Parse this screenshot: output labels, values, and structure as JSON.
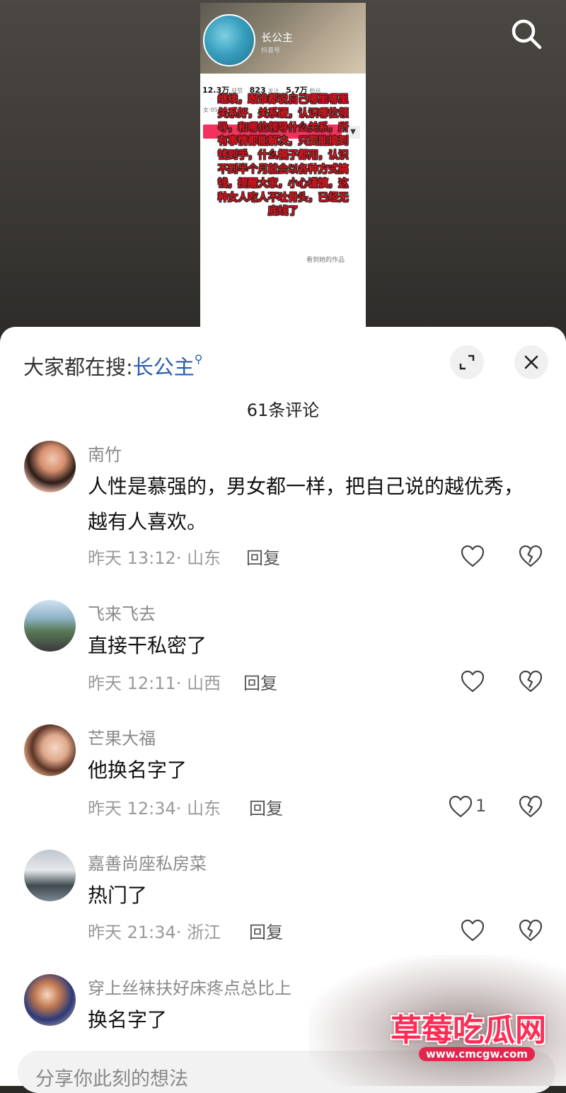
{
  "video": {
    "profile_name": "长公主",
    "profile_sub": "抖音号",
    "stats": [
      {
        "num": "12.3万",
        "label": "获赞"
      },
      {
        "num": "823",
        "label": "关注"
      },
      {
        "num": "5.7万",
        "label": "粉丝"
      }
    ],
    "bio_snippet": "女·95岁·",
    "works_hint": "看到她的作品",
    "overlay_text": "继续，跟谁都说自己哪里哪里关系好，关系硬，认识哪位领导，和哪位领导什么关系，所有事情都能解决，只要能搞到钱到手，什么幌子都用，认识不到半个月就会以各种方式搞钱，提醒大家，小心谨慎，这种女人吃人不吐骨头，已经无底线了"
  },
  "sheet": {
    "hot_search_label": "大家都在搜:",
    "hot_search_keyword": "长公主",
    "comment_count": "61条评论"
  },
  "comments": [
    {
      "user": "南竹",
      "text": "人性是慕强的，男女都一样，把自己说的越优秀，越有人喜欢。",
      "time": "昨天 13:12",
      "location": "山东",
      "reply": "回复",
      "likes": ""
    },
    {
      "user": "飞来飞去",
      "text": "直接干私密了",
      "time": "昨天 12:11",
      "location": "山西",
      "reply": "回复",
      "likes": ""
    },
    {
      "user": "芒果大福",
      "text": "他换名字了",
      "time": "昨天 12:34",
      "location": "山东",
      "reply": "回复",
      "likes": "1"
    },
    {
      "user": "嘉善尚座私房菜",
      "text": "热门了",
      "time": "昨天 21:34",
      "location": "浙江",
      "reply": "回复",
      "likes": ""
    },
    {
      "user": "穿上丝袜扶好床疼点总比上",
      "text": "换名字了"
    }
  ],
  "input": {
    "placeholder": "分享你此刻的想法"
  },
  "watermark": {
    "title": "草莓吃瓜网",
    "url": "www.cmcgw.com"
  },
  "icons": {
    "search": "search-icon",
    "expand": "expand-icon",
    "close": "close-icon",
    "like": "heart-outline-icon",
    "dislike": "broken-heart-icon"
  },
  "colors": {
    "accent_link": "#2a5caa",
    "overlay_red": "#e6111c",
    "watermark_pink": "#ff2d55"
  }
}
